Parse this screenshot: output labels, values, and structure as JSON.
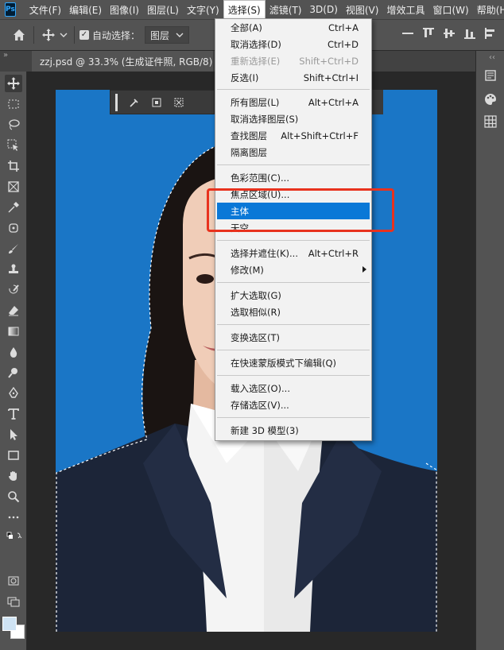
{
  "app": {
    "logo": "Ps"
  },
  "menubar": {
    "items": [
      {
        "label": "文件(F)"
      },
      {
        "label": "编辑(E)"
      },
      {
        "label": "图像(I)"
      },
      {
        "label": "图层(L)"
      },
      {
        "label": "文字(Y)"
      },
      {
        "label": "选择(S)"
      },
      {
        "label": "滤镜(T)"
      },
      {
        "label": "3D(D)"
      },
      {
        "label": "视图(V)"
      },
      {
        "label": "增效工具"
      },
      {
        "label": "窗口(W)"
      },
      {
        "label": "帮助(H)"
      }
    ],
    "active_index": 5
  },
  "options": {
    "auto_select_label": "自动选择：",
    "auto_select_checked": true,
    "target_value": "图层"
  },
  "document": {
    "tab_title": "zzj.psd @ 33.3% (生成证件照, RGB/8)",
    "tab_close": "×",
    "collapse_glyph": "»"
  },
  "select_menu": {
    "items": [
      {
        "label": "全部(A)",
        "shortcut": "Ctrl+A",
        "state": "normal"
      },
      {
        "label": "取消选择(D)",
        "shortcut": "Ctrl+D",
        "state": "normal"
      },
      {
        "label": "重新选择(E)",
        "shortcut": "Shift+Ctrl+D",
        "state": "disabled"
      },
      {
        "label": "反选(I)",
        "shortcut": "Shift+Ctrl+I",
        "state": "normal"
      },
      {
        "label": "所有图层(L)",
        "shortcut": "Alt+Ctrl+A",
        "state": "normal"
      },
      {
        "label": "取消选择图层(S)",
        "shortcut": "",
        "state": "normal"
      },
      {
        "label": "查找图层",
        "shortcut": "Alt+Shift+Ctrl+F",
        "state": "normal"
      },
      {
        "label": "隔离图层",
        "shortcut": "",
        "state": "normal"
      },
      {
        "label": "色彩范围(C)...",
        "shortcut": "",
        "state": "normal"
      },
      {
        "label": "焦点区域(U)...",
        "shortcut": "",
        "state": "normal"
      },
      {
        "label": "主体",
        "shortcut": "",
        "state": "highlight"
      },
      {
        "label": "天空",
        "shortcut": "",
        "state": "normal"
      },
      {
        "label": "选择并遮住(K)...",
        "shortcut": "Alt+Ctrl+R",
        "state": "normal"
      },
      {
        "label": "修改(M)",
        "shortcut": "",
        "state": "submenu"
      },
      {
        "label": "扩大选取(G)",
        "shortcut": "",
        "state": "normal"
      },
      {
        "label": "选取相似(R)",
        "shortcut": "",
        "state": "normal"
      },
      {
        "label": "变换选区(T)",
        "shortcut": "",
        "state": "normal"
      },
      {
        "label": "在快速蒙版模式下编辑(Q)",
        "shortcut": "",
        "state": "normal"
      },
      {
        "label": "载入选区(O)...",
        "shortcut": "",
        "state": "normal"
      },
      {
        "label": "存储选区(V)...",
        "shortcut": "",
        "state": "normal"
      },
      {
        "label": "新建 3D 模型(3)",
        "shortcut": "",
        "state": "normal"
      }
    ]
  },
  "colors": {
    "menubar_bg": "#535353",
    "highlight": "#0a78d7",
    "annotation": "#e8321e",
    "photo_background": "#1a76c6",
    "suit": "#1c2538",
    "foreground_swatch": "#cfe3f4"
  },
  "toolbar_icons": [
    "move-icon",
    "marquee-icon",
    "lasso-icon",
    "object-select-icon",
    "crop-icon",
    "frame-icon",
    "eyedropper-icon",
    "healing-icon",
    "brush-icon",
    "stamp-icon",
    "history-brush-icon",
    "eraser-icon",
    "gradient-icon",
    "blur-icon",
    "dodge-icon",
    "pen-icon",
    "type-icon",
    "path-select-icon",
    "rectangle-icon",
    "hand-icon",
    "zoom-icon",
    "more-icon"
  ]
}
